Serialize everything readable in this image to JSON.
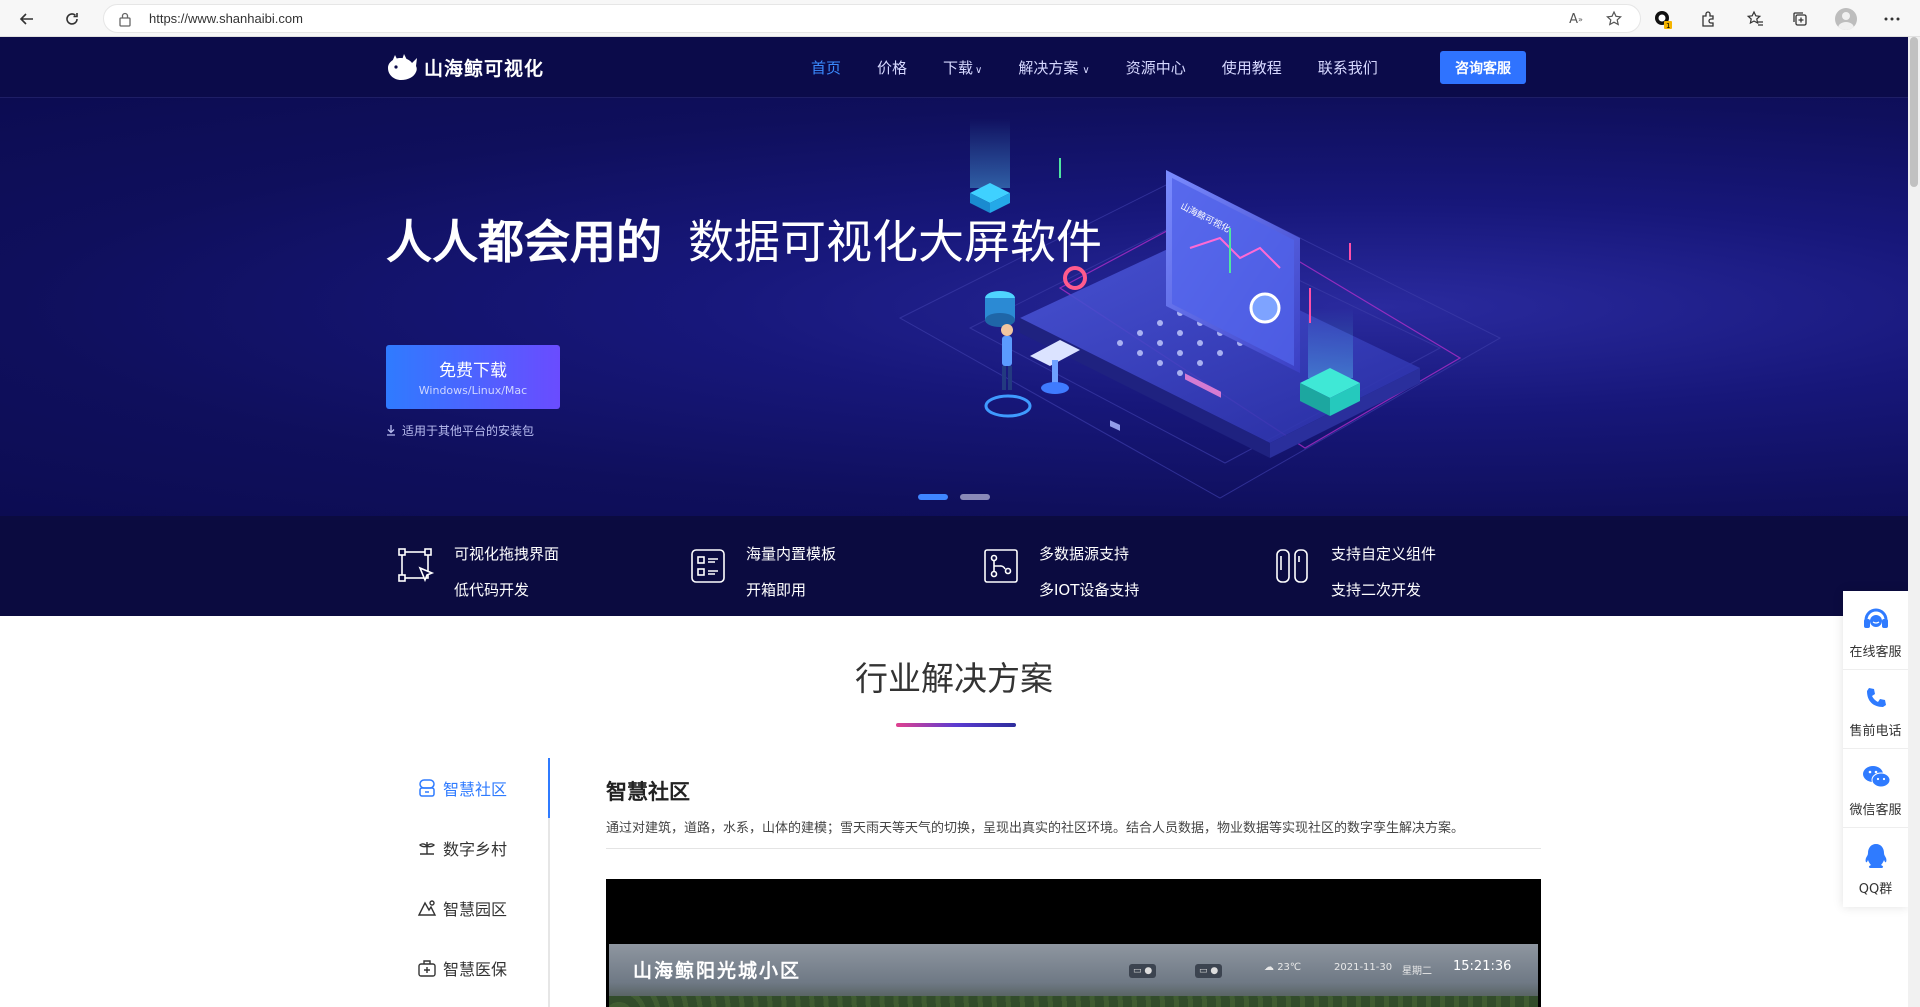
{
  "browser": {
    "url": "https://www.shanhaibi.com"
  },
  "header": {
    "logo_text": "山海鲸可视化",
    "nav": [
      {
        "label": "首页"
      },
      {
        "label": "价格"
      },
      {
        "label": "下载"
      },
      {
        "label": "解决方案"
      },
      {
        "label": "资源中心"
      },
      {
        "label": "使用教程"
      },
      {
        "label": "联系我们"
      }
    ],
    "consult_label": "咨询客服"
  },
  "hero": {
    "title_bold": "人人都会用的",
    "title_light": "数据可视化大屏软件",
    "download_label": "免费下载",
    "download_platforms": "Windows/Linux/Mac",
    "other_packages": "适用于其他平台的安装包",
    "screen_brand": "山海鲸可视化",
    "slides": 2,
    "active_slide": 1
  },
  "features": [
    {
      "line1": "可视化拖拽界面",
      "line2": "低代码开发",
      "icon": "drag-select-icon"
    },
    {
      "line1": "海量内置模板",
      "line2": "开箱即用",
      "icon": "template-list-icon"
    },
    {
      "line1": "多数据源支持",
      "line2": "多IOT设备支持",
      "icon": "data-source-icon"
    },
    {
      "line1": "支持自定义组件",
      "line2": "支持二次开发",
      "icon": "custom-component-icon"
    }
  ],
  "solutions": {
    "title": "行业解决方案",
    "tabs": [
      {
        "label": "智慧社区",
        "icon": "community-icon"
      },
      {
        "label": "数字乡村",
        "icon": "village-icon"
      },
      {
        "label": "智慧园区",
        "icon": "park-icon"
      },
      {
        "label": "智慧医保",
        "icon": "medical-icon"
      }
    ],
    "active": {
      "title": "智慧社区",
      "description": "通过对建筑，道路，水系，山体的建模；雪天雨天等天气的切换，呈现出真实的社区环境。结合人员数据，物业数据等实现社区的数字孪生解决方案。",
      "preview": {
        "title": "山海鲸阳光城小区",
        "date": "2021-11-30",
        "weekday": "星期二",
        "temperature": "23℃",
        "time": "15:21:36"
      }
    }
  },
  "float_bar": [
    {
      "label": "在线客服",
      "icon": "headset-icon"
    },
    {
      "label": "售前电话",
      "icon": "phone-icon"
    },
    {
      "label": "微信客服",
      "icon": "wechat-icon"
    },
    {
      "label": "QQ群",
      "icon": "qq-icon"
    }
  ],
  "colors": {
    "header_bg": "#0b0b4a",
    "accent": "#2f7bff",
    "feature_bg": "#0b0b40"
  }
}
